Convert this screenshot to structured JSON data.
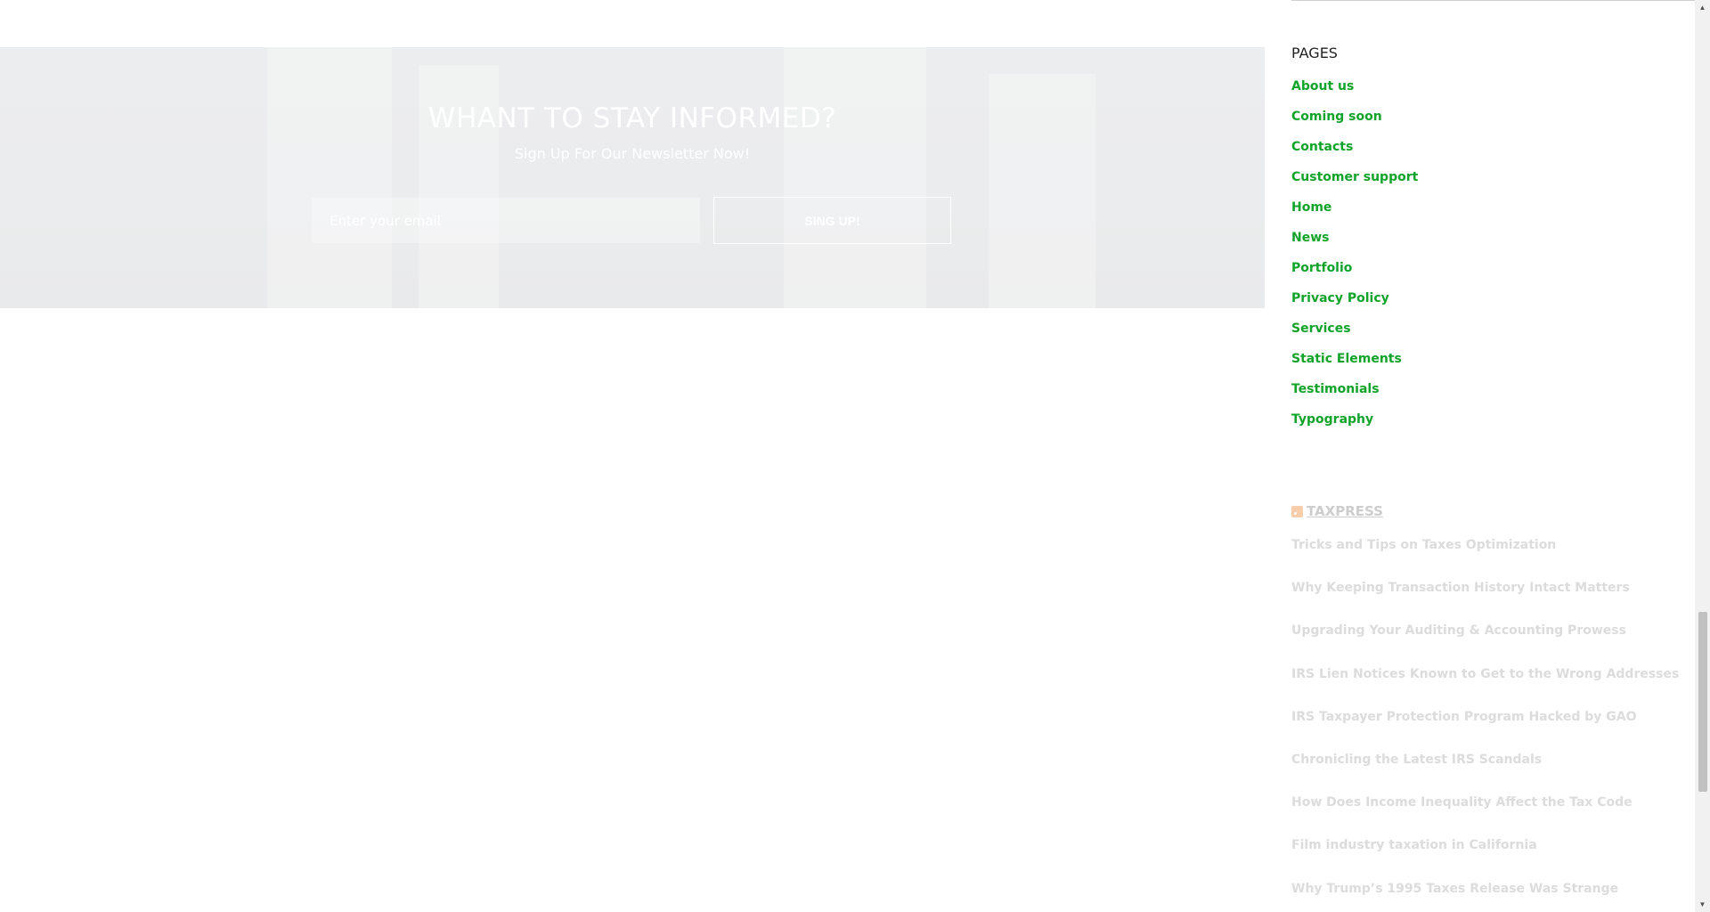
{
  "newsletter": {
    "title": "WHANT TO STAY INFORMED?",
    "subtitle": "Sign Up For Our Newsletter Now!",
    "email_placeholder": "Enter your email",
    "button_label": "SING UP!"
  },
  "sidebar": {
    "pages_title": "PAGES",
    "pages": [
      "About us",
      "Coming soon",
      "Contacts",
      "Customer support",
      "Home",
      "News",
      "Portfolio",
      "Privacy Policy",
      "Services",
      "Static Elements",
      "Testimonials",
      "Typography"
    ],
    "rss_title": "TAXPRESS",
    "rss_items": [
      "Tricks and Tips on Taxes Optimization",
      "Why Keeping Transaction History Intact Matters",
      "Upgrading Your Auditing & Accounting Prowess",
      "IRS Lien Notices Known to Get to the Wrong Addresses",
      "IRS Taxpayer Protection Program Hacked by GAO",
      "Chronicling the Latest IRS Scandals",
      "How Does Income Inequality Affect the Tax Code",
      "Film industry taxation in California",
      "Why Trump’s 1995 Taxes Release Was Strange"
    ]
  },
  "colors": {
    "link_green": "#12a32a",
    "newsletter_bg": "#ecedee",
    "rss_faded_text": "#dcdcdc"
  },
  "icons": {
    "rss": "rss-icon",
    "scroll_up": "scroll-up-arrow-icon",
    "scroll_down": "scroll-down-arrow-icon"
  },
  "scroll": {
    "position_fraction": 0.72
  }
}
